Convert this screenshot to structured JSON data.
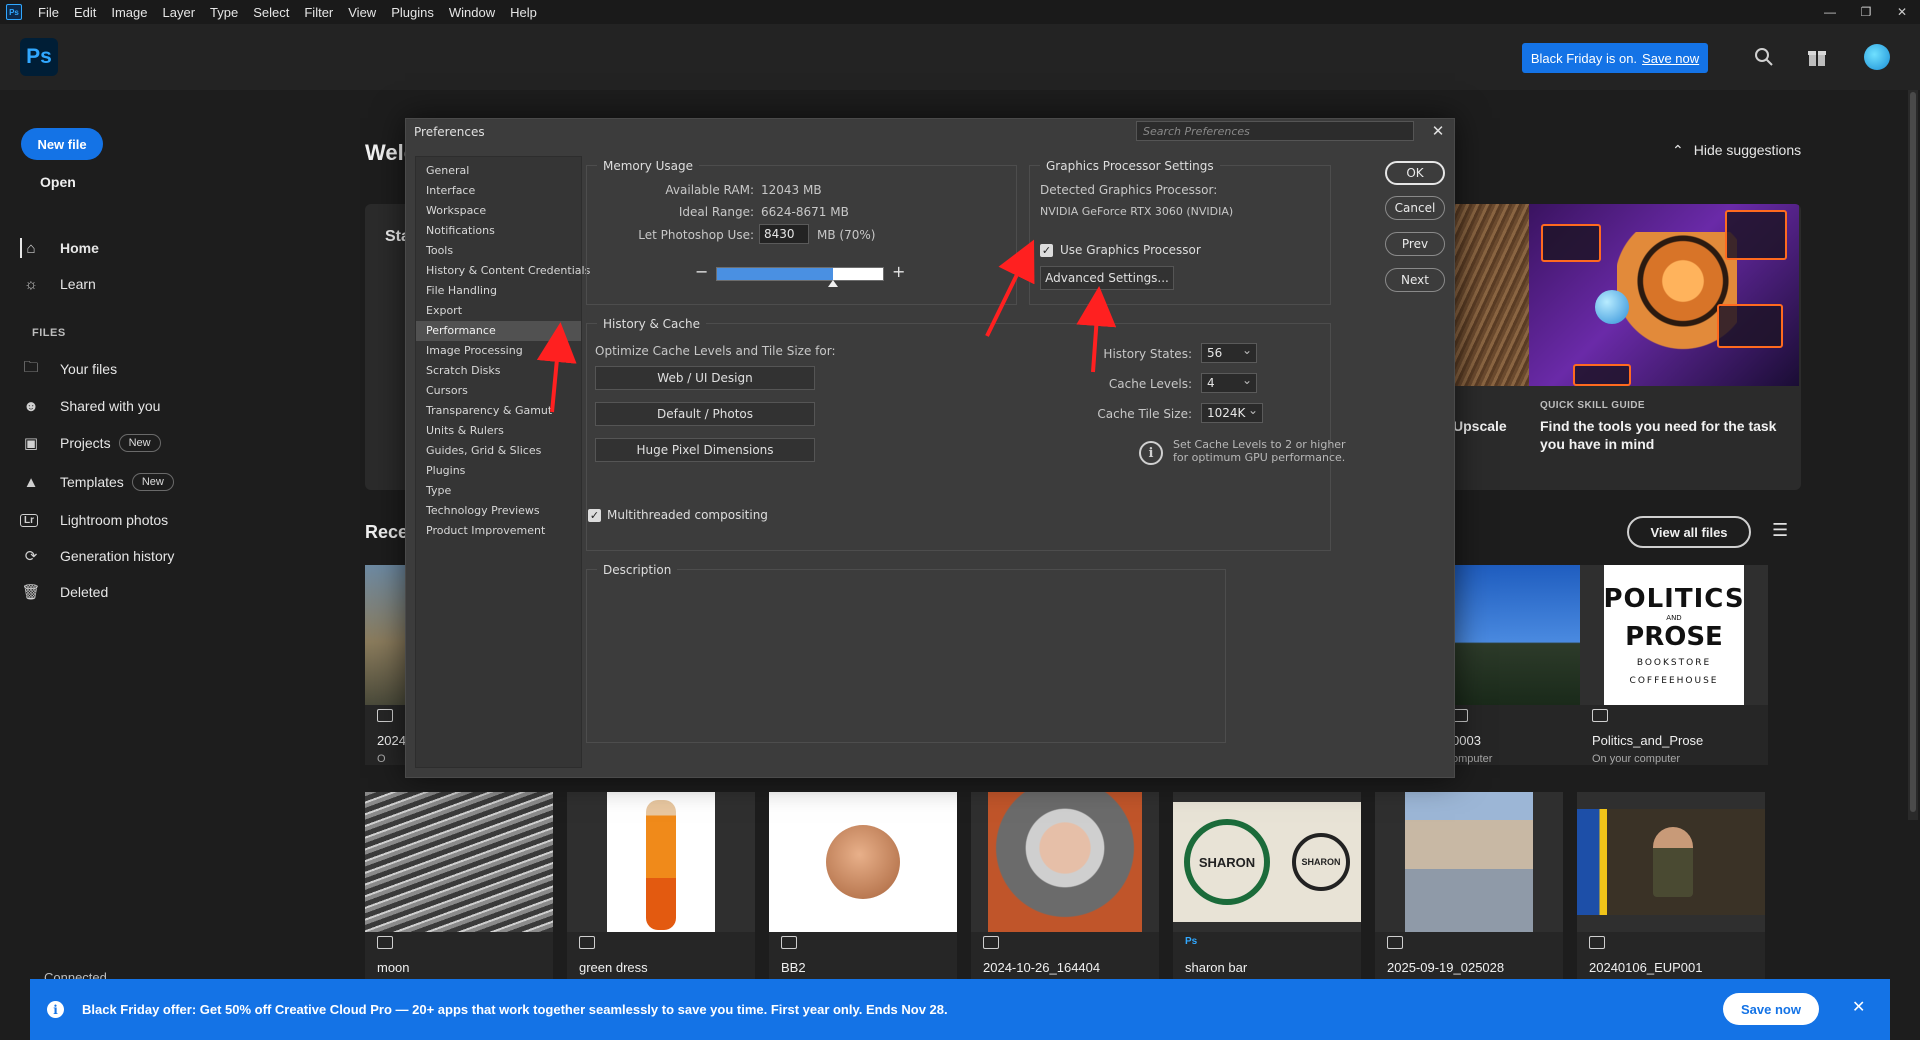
{
  "menubar": {
    "logo": "Ps",
    "items": [
      "File",
      "Edit",
      "Image",
      "Layer",
      "Type",
      "Select",
      "Filter",
      "View",
      "Plugins",
      "Window",
      "Help"
    ]
  },
  "header": {
    "logo": "Ps",
    "promo_text": "Black Friday is on.",
    "promo_link": "Save now"
  },
  "leftnav": {
    "new_file": "New file",
    "open": "Open",
    "home": "Home",
    "learn": "Learn",
    "files_section": "FILES",
    "your_files": "Your files",
    "shared": "Shared with you",
    "projects": "Projects",
    "projects_badge": "New",
    "templates": "Templates",
    "templates_badge": "New",
    "lightroom": "Lightroom photos",
    "generation_history": "Generation history",
    "deleted": "Deleted",
    "connected": "Connected"
  },
  "home": {
    "welcome": "Welc",
    "hide_suggestions": "Hide suggestions",
    "start_label": "Sta",
    "upscale_label": "Upscale",
    "skill_tag": "QUICK SKILL GUIDE",
    "skill_title": "Find the tools you need for the task you have in mind",
    "recent": "Recen",
    "view_all": "View all files"
  },
  "recent_files_top": [
    {
      "name": "2024",
      "location": "O"
    },
    {
      "name": "0003",
      "location": "omputer"
    },
    {
      "name": "Politics_and_Prose",
      "location": "On your computer"
    }
  ],
  "recent_files_bottom": [
    {
      "name": "moon"
    },
    {
      "name": "green dress"
    },
    {
      "name": "BB2"
    },
    {
      "name": "2024-10-26_164404"
    },
    {
      "name": "sharon bar"
    },
    {
      "name": "2025-09-19_025028"
    },
    {
      "name": "20240106_EUP001"
    }
  ],
  "thumb_text": {
    "politics_line1": "POLITICS",
    "politics_and": "AND",
    "politics_line2": "PROSE",
    "politics_line3": "BOOKSTORE",
    "politics_line4": "COFFEEHOUSE",
    "sharon": "SHARON",
    "ps_badge": "Ps"
  },
  "prefs": {
    "title": "Preferences",
    "search_placeholder": "Search Preferences",
    "categories": [
      "General",
      "Interface",
      "Workspace",
      "Notifications",
      "Tools",
      "History & Content Credentials",
      "File Handling",
      "Export",
      "Performance",
      "Image Processing",
      "Scratch Disks",
      "Cursors",
      "Transparency & Gamut",
      "Units & Rulers",
      "Guides, Grid & Slices",
      "Plugins",
      "Type",
      "Technology Previews",
      "Product Improvement"
    ],
    "selected_category": "Performance",
    "memory": {
      "title": "Memory Usage",
      "available_label": "Available RAM:",
      "available_value": "12043 MB",
      "ideal_label": "Ideal Range:",
      "ideal_value": "6624-8671 MB",
      "use_label": "Let Photoshop Use:",
      "use_value": "8430",
      "use_unit": "MB (70%)",
      "slider_fraction": 0.7
    },
    "gpu": {
      "title": "Graphics Processor Settings",
      "detected_label": "Detected Graphics Processor:",
      "detected_value": "NVIDIA GeForce RTX 3060 (NVIDIA)",
      "use_gpu_label": "Use Graphics Processor",
      "use_gpu_checked": true,
      "advanced": "Advanced Settings..."
    },
    "history": {
      "title": "History & Cache",
      "optimize_label": "Optimize Cache Levels and Tile Size for:",
      "btn_web": "Web / UI Design",
      "btn_default": "Default / Photos",
      "btn_huge": "Huge Pixel Dimensions",
      "states_label": "History States:",
      "states_value": "56",
      "levels_label": "Cache Levels:",
      "levels_value": "4",
      "tile_label": "Cache Tile Size:",
      "tile_value": "1024K",
      "hint": "Set Cache Levels to 2 or higher for optimum GPU performance."
    },
    "multithreaded_label": "Multithreaded compositing",
    "multithreaded_checked": true,
    "description_title": "Description",
    "buttons": {
      "ok": "OK",
      "cancel": "Cancel",
      "prev": "Prev",
      "next": "Next"
    }
  },
  "offer": {
    "text": "Black Friday offer: Get 50% off Creative Cloud Pro — 20+ apps that work together seamlessly to save you time. First year only. Ends Nov 28.",
    "button": "Save now"
  },
  "colors": {
    "accent": "#1473e6",
    "annotation": "#ff2020"
  }
}
